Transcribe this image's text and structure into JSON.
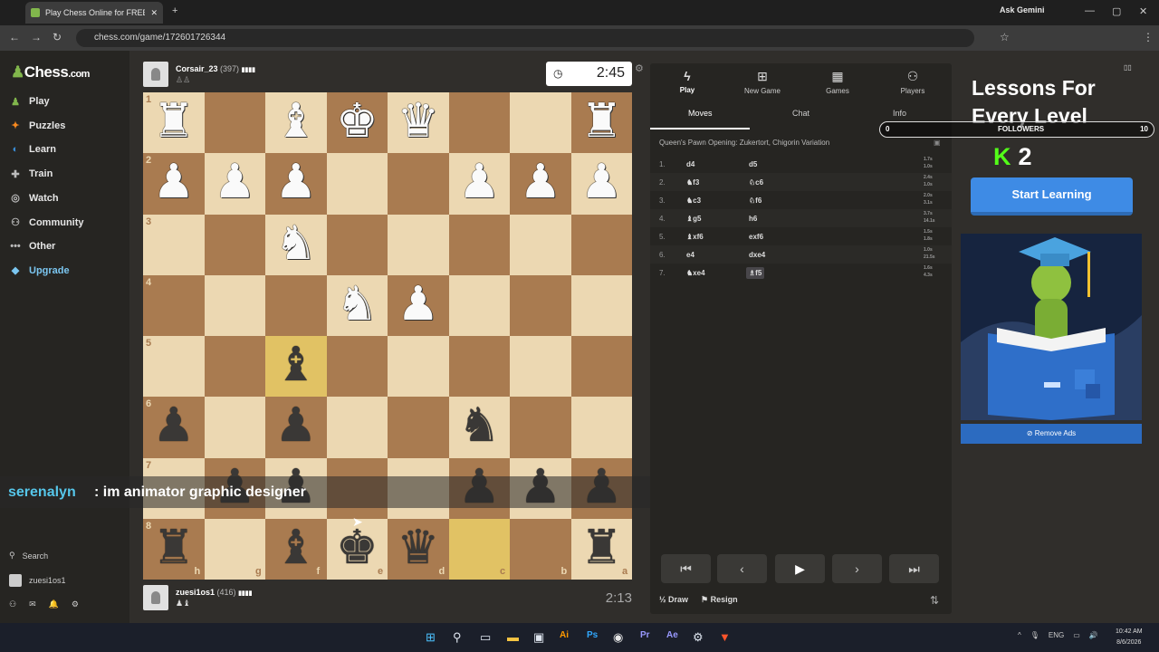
{
  "browser": {
    "tab_title": "Play Chess Online for FREE",
    "url": "chess.com/game/172601726344",
    "gemini": "Ask Gemini"
  },
  "sidebar": {
    "logo_text": "Chess",
    "logo_suffix": ".com",
    "items": [
      {
        "label": "Play",
        "icon": "play-icon",
        "color": "#81b64c"
      },
      {
        "label": "Puzzles",
        "icon": "puzzle-icon",
        "color": "#f7891f"
      },
      {
        "label": "Learn",
        "icon": "learn-icon",
        "color": "#3a8fd9"
      },
      {
        "label": "Train",
        "icon": "train-icon",
        "color": "#bbbbbb"
      },
      {
        "label": "Watch",
        "icon": "watch-icon",
        "color": "#bbbbbb"
      },
      {
        "label": "Community",
        "icon": "community-icon",
        "color": "#bbbbbb"
      },
      {
        "label": "Other",
        "icon": "more-icon",
        "color": "#bbbbbb"
      },
      {
        "label": "Upgrade",
        "icon": "diamond-icon",
        "color": "#7bc6f0"
      }
    ],
    "search": "Search",
    "user": "zuesi1os1"
  },
  "top_player": {
    "name": "Corsair_23",
    "rating": "(397)",
    "clock": "2:45"
  },
  "bottom_player": {
    "name": "zuesi1os1",
    "rating": "(416)",
    "clock": "2:13"
  },
  "board": {
    "ranks": [
      "1",
      "2",
      "3",
      "4",
      "5",
      "6",
      "7",
      "8"
    ],
    "files": [
      "h",
      "g",
      "f",
      "e",
      "d",
      "c",
      "b",
      "a"
    ],
    "highlight": [
      "r4c2",
      "r7c5"
    ],
    "pieces": [
      {
        "r": 0,
        "c": 0,
        "p": "♜",
        "side": "w"
      },
      {
        "r": 0,
        "c": 2,
        "p": "♝",
        "side": "w"
      },
      {
        "r": 0,
        "c": 3,
        "p": "♚",
        "side": "w"
      },
      {
        "r": 0,
        "c": 4,
        "p": "♛",
        "side": "w"
      },
      {
        "r": 0,
        "c": 7,
        "p": "♜",
        "side": "w"
      },
      {
        "r": 1,
        "c": 0,
        "p": "♟",
        "side": "w"
      },
      {
        "r": 1,
        "c": 1,
        "p": "♟",
        "side": "w"
      },
      {
        "r": 1,
        "c": 2,
        "p": "♟",
        "side": "w"
      },
      {
        "r": 1,
        "c": 5,
        "p": "♟",
        "side": "w"
      },
      {
        "r": 1,
        "c": 6,
        "p": "♟",
        "side": "w"
      },
      {
        "r": 1,
        "c": 7,
        "p": "♟",
        "side": "w"
      },
      {
        "r": 2,
        "c": 2,
        "p": "♞",
        "side": "w"
      },
      {
        "r": 3,
        "c": 3,
        "p": "♞",
        "side": "w"
      },
      {
        "r": 3,
        "c": 4,
        "p": "♟",
        "side": "w"
      },
      {
        "r": 4,
        "c": 2,
        "p": "♝",
        "side": "b"
      },
      {
        "r": 5,
        "c": 0,
        "p": "♟",
        "side": "b"
      },
      {
        "r": 5,
        "c": 2,
        "p": "♟",
        "side": "b"
      },
      {
        "r": 5,
        "c": 5,
        "p": "♞",
        "side": "b"
      },
      {
        "r": 6,
        "c": 1,
        "p": "♟",
        "side": "b"
      },
      {
        "r": 6,
        "c": 2,
        "p": "♟",
        "side": "b"
      },
      {
        "r": 6,
        "c": 5,
        "p": "♟",
        "side": "b"
      },
      {
        "r": 6,
        "c": 6,
        "p": "♟",
        "side": "b"
      },
      {
        "r": 6,
        "c": 7,
        "p": "♟",
        "side": "b"
      },
      {
        "r": 7,
        "c": 0,
        "p": "♜",
        "side": "b"
      },
      {
        "r": 7,
        "c": 2,
        "p": "♝",
        "side": "b"
      },
      {
        "r": 7,
        "c": 3,
        "p": "♚",
        "side": "b"
      },
      {
        "r": 7,
        "c": 4,
        "p": "♛",
        "side": "b"
      },
      {
        "r": 7,
        "c": 7,
        "p": "♜",
        "side": "b"
      }
    ]
  },
  "chat_overlay": {
    "user": "serenalyn",
    "message": ": im animator graphic designer"
  },
  "panel": {
    "tabs": [
      "Play",
      "New Game",
      "Games",
      "Players"
    ],
    "subtabs": [
      "Moves",
      "Chat",
      "Info"
    ],
    "opening": "Queen's Pawn Opening: Zukertort, Chigorin Variation",
    "moves": [
      {
        "n": "1.",
        "w": "d4",
        "b": "d5",
        "t1": "1.7s",
        "t2": "1.0s"
      },
      {
        "n": "2.",
        "w": "♞f3",
        "b": "♘c6",
        "t1": "2.4s",
        "t2": "1.0s"
      },
      {
        "n": "3.",
        "w": "♞c3",
        "b": "♘f6",
        "t1": "2.0s",
        "t2": "3.1s"
      },
      {
        "n": "4.",
        "w": "♝g5",
        "b": "h6",
        "t1": "3.7s",
        "t2": "14.1s"
      },
      {
        "n": "5.",
        "w": "♝xf6",
        "b": "exf6",
        "t1": "1.5s",
        "t2": "1.8s"
      },
      {
        "n": "6.",
        "w": "e4",
        "b": "dxe4",
        "t1": "1.0s",
        "t2": "21.5s"
      },
      {
        "n": "7.",
        "w": "♞xe4",
        "b": "♗f5",
        "t1": "1.6s",
        "t2": "4.3s"
      }
    ],
    "draw": "Draw",
    "resign": "Resign"
  },
  "ad": {
    "title": "Lessons For Every Level",
    "followers_min": "0",
    "followers_label": "FOLLOWERS",
    "followers_max": "10",
    "followers_count": "2",
    "cta": "Start Learning",
    "remove": "Remove Ads"
  },
  "system": {
    "time": "10:42 AM",
    "date": "8/6/2026",
    "lang": "ENG"
  }
}
